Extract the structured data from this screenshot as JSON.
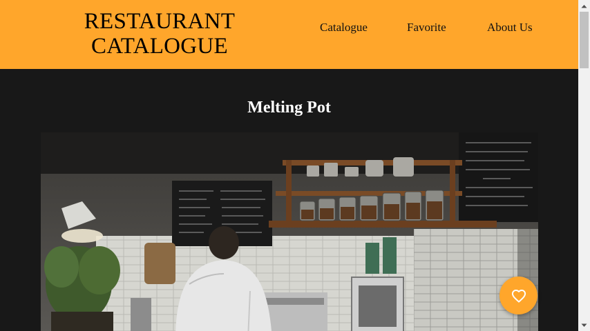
{
  "header": {
    "brand_line1": "RESTAURANT",
    "brand_line2": "CATALOGUE",
    "nav": [
      {
        "label": "Catalogue"
      },
      {
        "label": "Favorite"
      },
      {
        "label": "About Us"
      }
    ]
  },
  "detail": {
    "title": "Melting Pot"
  },
  "favorite_button": {
    "icon": "heart-icon"
  },
  "colors": {
    "accent": "#ffa62b",
    "background": "#181818"
  },
  "scrollbar": {
    "up_icon": "chevron-up-icon",
    "down_icon": "chevron-down-icon"
  }
}
